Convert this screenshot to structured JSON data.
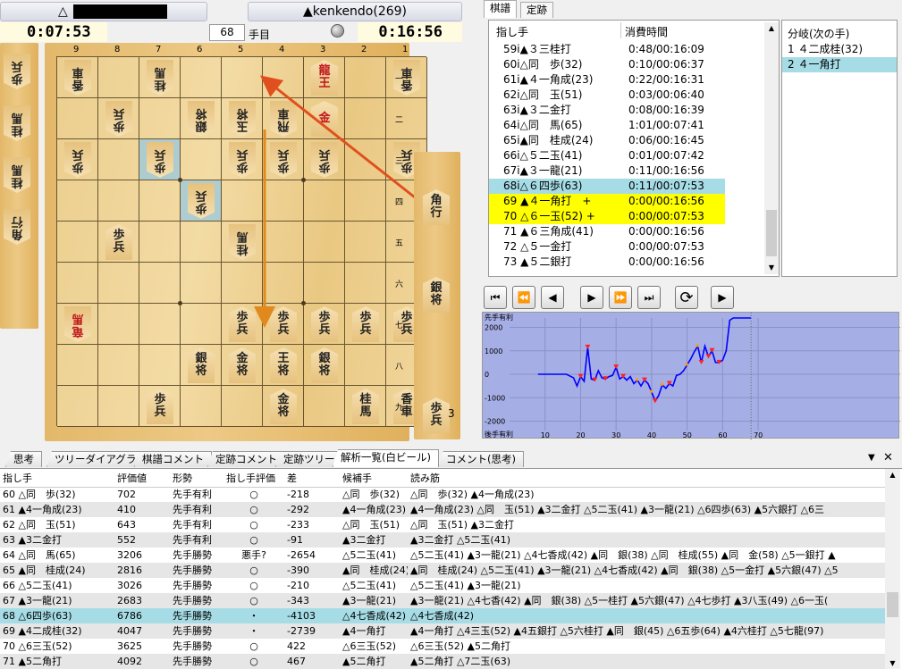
{
  "players": {
    "gote_prefix": "△",
    "sente_label": "▲kenkendo(269)"
  },
  "clocks": {
    "gote": "0:07:53",
    "sente": "0:16:56"
  },
  "move_counter": {
    "value": "68",
    "unit": "手目"
  },
  "board": {
    "file_labels": [
      "9",
      "8",
      "7",
      "6",
      "5",
      "4",
      "3",
      "2",
      "1"
    ],
    "rank_labels": [
      "一",
      "二",
      "三",
      "四",
      "五",
      "六",
      "七",
      "八",
      "九"
    ],
    "pieces": [
      {
        "f": 9,
        "r": 1,
        "t": "香車",
        "side": "gote"
      },
      {
        "f": 7,
        "r": 1,
        "t": "桂馬",
        "side": "gote"
      },
      {
        "f": 3,
        "r": 1,
        "t": "龍王",
        "side": "sente",
        "red": true
      },
      {
        "f": 1,
        "r": 1,
        "t": "香車",
        "side": "gote"
      },
      {
        "f": 8,
        "r": 2,
        "t": "歩兵",
        "side": "gote"
      },
      {
        "f": 6,
        "r": 2,
        "t": "銀将",
        "side": "gote"
      },
      {
        "f": 5,
        "r": 2,
        "t": "玉将",
        "side": "gote"
      },
      {
        "f": 4,
        "r": 2,
        "t": "飛車",
        "side": "gote"
      },
      {
        "f": 3,
        "r": 2,
        "t": "金",
        "side": "sente",
        "red": true
      },
      {
        "f": 9,
        "r": 3,
        "t": "歩兵",
        "side": "gote"
      },
      {
        "f": 7,
        "r": 3,
        "t": "歩兵",
        "side": "gote"
      },
      {
        "f": 5,
        "r": 3,
        "t": "歩兵",
        "side": "gote"
      },
      {
        "f": 4,
        "r": 3,
        "t": "歩兵",
        "side": "gote"
      },
      {
        "f": 3,
        "r": 3,
        "t": "歩兵",
        "side": "gote"
      },
      {
        "f": 1,
        "r": 3,
        "t": "歩兵",
        "side": "gote"
      },
      {
        "f": 6,
        "r": 4,
        "t": "歩兵",
        "side": "gote"
      },
      {
        "f": 8,
        "r": 5,
        "t": "歩兵",
        "side": "sente"
      },
      {
        "f": 5,
        "r": 5,
        "t": "桂馬",
        "side": "gote"
      },
      {
        "f": 9,
        "r": 7,
        "t": "竜馬",
        "side": "gote",
        "red": true
      },
      {
        "f": 5,
        "r": 7,
        "t": "歩兵",
        "side": "sente"
      },
      {
        "f": 4,
        "r": 7,
        "t": "歩兵",
        "side": "sente"
      },
      {
        "f": 3,
        "r": 7,
        "t": "歩兵",
        "side": "sente"
      },
      {
        "f": 2,
        "r": 7,
        "t": "歩兵",
        "side": "sente"
      },
      {
        "f": 1,
        "r": 7,
        "t": "歩兵",
        "side": "sente"
      },
      {
        "f": 6,
        "r": 8,
        "t": "銀将",
        "side": "sente"
      },
      {
        "f": 5,
        "r": 8,
        "t": "金将",
        "side": "sente"
      },
      {
        "f": 4,
        "r": 8,
        "t": "王将",
        "side": "sente"
      },
      {
        "f": 3,
        "r": 8,
        "t": "銀将",
        "side": "sente"
      },
      {
        "f": 7,
        "r": 9,
        "t": "歩兵",
        "side": "sente"
      },
      {
        "f": 4,
        "r": 9,
        "t": "金将",
        "side": "sente"
      },
      {
        "f": 2,
        "r": 9,
        "t": "桂馬",
        "side": "sente"
      },
      {
        "f": 1,
        "r": 9,
        "t": "香車",
        "side": "sente"
      }
    ],
    "gote_hand": [
      "歩兵",
      "桂馬",
      "桂馬",
      "角行"
    ],
    "sente_hand": [
      {
        "t": "角行"
      },
      {
        "t": "銀将"
      },
      {
        "t": "歩兵",
        "count": "3"
      }
    ]
  },
  "kifu_tabs": [
    "棋譜",
    "定跡"
  ],
  "kifu": {
    "headers": [
      "指し手",
      "消費時間"
    ],
    "rows": [
      {
        "m": "59i▲３三桂打",
        "t": "0:48/00:16:09"
      },
      {
        "m": "60i△同　歩(32)",
        "t": "0:10/00:06:37"
      },
      {
        "m": "61i▲４一角成(23)",
        "t": "0:22/00:16:31"
      },
      {
        "m": "62i△同　玉(51)",
        "t": "0:03/00:06:40"
      },
      {
        "m": "63i▲３二金打",
        "t": "0:08/00:16:39"
      },
      {
        "m": "64i△同　馬(65)",
        "t": "1:01/00:07:41"
      },
      {
        "m": "65i▲同　桂成(24)",
        "t": "0:06/00:16:45"
      },
      {
        "m": "66i△５二玉(41)",
        "t": "0:01/00:07:42"
      },
      {
        "m": "67i▲３一龍(21)",
        "t": "0:11/00:16:56"
      },
      {
        "m": "68i△６四歩(63)",
        "t": "0:11/00:07:53",
        "hl": "cur"
      },
      {
        "m": "69 ▲４一角打　+",
        "t": "0:00/00:16:56",
        "hl": "branch"
      },
      {
        "m": "70 △６一玉(52) +",
        "t": "0:00/00:07:53",
        "hl": "branch"
      },
      {
        "m": "71 ▲６三角成(41)",
        "t": "0:00/00:16:56"
      },
      {
        "m": "72 △５一金打",
        "t": "0:00/00:07:53"
      },
      {
        "m": "73 ▲５二銀打",
        "t": "0:00/00:16:56"
      }
    ]
  },
  "branch": {
    "header": "分岐(次の手)",
    "items": [
      "1  ４二成桂(32)",
      "2  ４一角打"
    ]
  },
  "eval_graph": {
    "top_label": "先手有利",
    "bottom_label": "後手有利",
    "y_ticks": [
      "2000",
      "1000",
      "0",
      "-1000",
      "-2000"
    ],
    "x_ticks": [
      "10",
      "20",
      "30",
      "40",
      "50",
      "60",
      "70"
    ]
  },
  "chart_data": {
    "type": "line",
    "title": "",
    "ylim": [
      -2400,
      2400
    ],
    "xlim": [
      0,
      110
    ],
    "x": [
      8,
      10,
      12,
      14,
      16,
      18,
      19,
      20,
      21,
      22,
      23,
      24,
      25,
      26,
      27,
      28,
      29,
      30,
      31,
      32,
      33,
      34,
      35,
      36,
      37,
      38,
      39,
      40,
      41,
      42,
      43,
      44,
      45,
      46,
      47,
      48,
      49,
      50,
      51,
      52,
      53,
      54,
      55,
      56,
      57,
      58,
      59,
      60,
      61,
      62,
      63,
      64,
      65,
      66,
      67,
      68
    ],
    "values": [
      0,
      0,
      0,
      0,
      0,
      -150,
      -500,
      -100,
      -300,
      1150,
      -200,
      -250,
      150,
      -150,
      -200,
      -100,
      -50,
      300,
      -200,
      -100,
      -250,
      -100,
      -400,
      -250,
      -500,
      -250,
      -400,
      -750,
      -1150,
      -900,
      -450,
      -600,
      -400,
      -500,
      -50,
      0,
      150,
      400,
      650,
      950,
      1200,
      500,
      1200,
      750,
      1000,
      500,
      500,
      600,
      1000,
      2300,
      2450,
      2500,
      2550,
      2600,
      2700,
      2800
    ],
    "grid": true
  },
  "bottom_tabs": [
    "思考",
    "ツリーダイアグラム",
    "棋譜コメント",
    "定跡コメント",
    "定跡ツリー",
    "解析一覧(白ビール)",
    "コメント(思考)"
  ],
  "analysis": {
    "headers": [
      "指し手",
      "評価値",
      "形勢",
      "指し手評価",
      "差",
      "候補手",
      "読み筋"
    ],
    "rows": [
      [
        "60 △同　歩(32)",
        "702",
        "先手有利",
        "○",
        "-218",
        "△同　歩(32)",
        "△同　歩(32) ▲4一角成(23)"
      ],
      [
        "61 ▲4一角成(23)",
        "410",
        "先手有利",
        "○",
        "-292",
        "▲4一角成(23)",
        "▲4一角成(23) △同　玉(51) ▲3二金打 △5二玉(41) ▲3一龍(21) △6四歩(63) ▲5六銀打 △6三"
      ],
      [
        "62 △同　玉(51)",
        "643",
        "先手有利",
        "○",
        "-233",
        "△同　玉(51)",
        "△同　玉(51) ▲3二金打"
      ],
      [
        "63 ▲3二金打",
        "552",
        "先手有利",
        "○",
        "-91",
        "▲3二金打",
        "▲3二金打 △5二玉(41)"
      ],
      [
        "64 △同　馬(65)",
        "3206",
        "先手勝勢",
        "悪手?",
        "-2654",
        "△5二玉(41)",
        "△5二玉(41) ▲3一龍(21) △4七香成(42) ▲同　銀(38) △同　桂成(55) ▲同　金(58) △5一銀打 ▲"
      ],
      [
        "65 ▲同　桂成(24)",
        "2816",
        "先手勝勢",
        "○",
        "-390",
        "▲同　桂成(24)",
        "▲同　桂成(24) △5二玉(41) ▲3一龍(21) △4七香成(42) ▲同　銀(38) △5一金打 ▲5六銀(47) △5"
      ],
      [
        "66 △5二玉(41)",
        "3026",
        "先手勝勢",
        "○",
        "-210",
        "△5二玉(41)",
        "△5二玉(41) ▲3一龍(21)"
      ],
      [
        "67 ▲3一龍(21)",
        "2683",
        "先手勝勢",
        "○",
        "-343",
        "▲3一龍(21)",
        "▲3一龍(21) △4七香(42) ▲同　銀(38) △5一桂打 ▲5六銀(47) △4七歩打 ▲3八玉(49) △6一玉("
      ],
      [
        "68 △6四歩(63)",
        "6786",
        "先手勝勢",
        "・",
        "-4103",
        "△4七香成(42)",
        "△4七香成(42)"
      ],
      [
        "69 ▲4二成桂(32)",
        "4047",
        "先手勝勢",
        "・",
        "-2739",
        "▲4一角打",
        "▲4一角打 △4三玉(52) ▲4五銀打 △5六桂打 ▲同　銀(45) △6五歩(64) ▲4六桂打 △5七龍(97)"
      ],
      [
        "70 △6三玉(52)",
        "3625",
        "先手勝勢",
        "○",
        "422",
        "△6三玉(52)",
        "△6三玉(52) ▲5二角打"
      ],
      [
        "71 ▲5二角打",
        "4092",
        "先手勝勢",
        "○",
        "467",
        "▲5二角打",
        "▲5二角打 △7二玉(63)"
      ]
    ],
    "highlight_row": 8
  },
  "close_label": "✕",
  "dropdown_label": "▼"
}
